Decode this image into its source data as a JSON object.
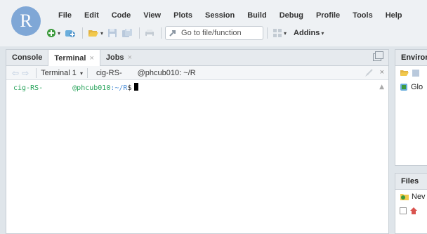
{
  "logo": {
    "letter": "R"
  },
  "menu": [
    "File",
    "Edit",
    "Code",
    "View",
    "Plots",
    "Session",
    "Build",
    "Debug",
    "Profile",
    "Tools",
    "Help"
  ],
  "toolbar": {
    "goto_placeholder": "Go to file/function",
    "addins_label": "Addins"
  },
  "console_pane": {
    "tabs": [
      {
        "label": "Console",
        "closable": false
      },
      {
        "label": "Terminal",
        "closable": true
      },
      {
        "label": "Jobs",
        "closable": true
      }
    ],
    "close_glyph": "×",
    "terminal_selector": "Terminal 1",
    "terminal_session": "cig-RS-",
    "terminal_host_path": "@phcub010: ~/R",
    "prompt": {
      "user": "cig-RS-",
      "host": "@phcub010",
      "path": ":~/R",
      "symbol": "$"
    }
  },
  "right_top_pane": {
    "tab_label": "Environ",
    "row_label": "Glo"
  },
  "right_bottom_pane": {
    "tab_label": "Files",
    "new_label": "Nev"
  },
  "colors": {
    "accent_blue": "#7fa7d6",
    "prompt_green": "#27a35a",
    "path_blue": "#4a8cd6"
  }
}
